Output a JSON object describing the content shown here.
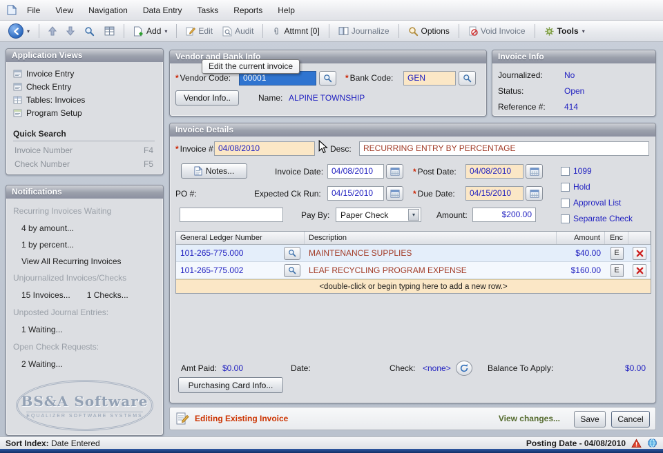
{
  "colors": {
    "required_field_bg": "#fbe7c6",
    "value_text": "#1f1fc0",
    "description_text": "#a23c28",
    "editing_status_text": "#cc3300",
    "selection_bg": "#2f74d0"
  },
  "menu": {
    "items": [
      "File",
      "View",
      "Navigation",
      "Data Entry",
      "Tasks",
      "Reports",
      "Help"
    ]
  },
  "toolbar": {
    "add": "Add",
    "edit": "Edit",
    "audit": "Audit",
    "attmnt": "Attmnt [0]",
    "journalize": "Journalize",
    "options": "Options",
    "void_invoice": "Void Invoice",
    "tools": "Tools"
  },
  "tooltip": {
    "text": "Edit the current invoice"
  },
  "sidebar": {
    "app_views": {
      "title": "Application Views",
      "items": [
        "Invoice Entry",
        "Check Entry",
        "Tables: Invoices",
        "Program Setup"
      ]
    },
    "quick_search": {
      "title": "Quick Search",
      "items": [
        {
          "label": "Invoice Number",
          "key": "F4"
        },
        {
          "label": "Check Number",
          "key": "F5"
        }
      ]
    },
    "notifications": {
      "title": "Notifications",
      "rows": [
        "Recurring Invoices Waiting",
        "4 by amount...",
        "1 by percent...",
        "View All Recurring Invoices",
        "Unjournalized Invoices/Checks",
        "15 Invoices...",
        "1 Checks...",
        "Unposted Journal Entries:",
        "1 Waiting...",
        "Open Check Requests:",
        "2 Waiting..."
      ]
    },
    "logo": {
      "line1": "BS&A Software",
      "line2": "EQUALIZER SOFTWARE SYSTEMS"
    }
  },
  "vendor_bank": {
    "title": "Vendor and Bank Info",
    "vendor_code_label": "Vendor Code:",
    "vendor_code": "00001",
    "bank_code_label": "Bank Code:",
    "bank_code": "GEN",
    "vendor_info_button": "Vendor Info..",
    "name_label": "Name:",
    "name": "ALPINE TOWNSHIP"
  },
  "invoice_info": {
    "title": "Invoice Info",
    "rows": [
      {
        "label": "Journalized:",
        "value": "No"
      },
      {
        "label": "Status:",
        "value": "Open"
      },
      {
        "label": "Reference #:",
        "value": "414"
      }
    ]
  },
  "invoice_details": {
    "title": "Invoice Details",
    "invoice_no_label": "Invoice #:",
    "invoice_no": "04/08/2010",
    "desc_label": "Desc:",
    "desc": "RECURRING ENTRY BY PERCENTAGE",
    "notes_button": "Notes...",
    "invoice_date_label": "Invoice Date:",
    "invoice_date": "04/08/2010",
    "post_date_label": "Post Date:",
    "post_date": "04/08/2010",
    "expected_ck_label": "Expected Ck Run:",
    "expected_ck": "04/15/2010",
    "due_date_label": "Due Date:",
    "due_date": "04/15/2010",
    "po_label": "PO #:",
    "po_value": "",
    "pay_by_label": "Pay By:",
    "pay_by": "Paper Check",
    "amount_label": "Amount:",
    "amount": "$200.00",
    "checkboxes": [
      "1099",
      "Hold",
      "Approval List",
      "Separate Check"
    ],
    "grid": {
      "columns": [
        "General Ledger Number",
        "Description",
        "Amount",
        "Enc"
      ],
      "rows": [
        {
          "gl": "101-265-775.000",
          "desc": "MAINTENANCE SUPPLIES",
          "amount": "$40.00",
          "enc": "E"
        },
        {
          "gl": "101-265-775.002",
          "desc": "LEAF RECYCLING PROGRAM EXPENSE",
          "amount": "$160.00",
          "enc": "E"
        }
      ],
      "new_row_hint": "<double-click or begin typing here to add a new row.>"
    },
    "amt_paid_label": "Amt Paid:",
    "amt_paid": "$0.00",
    "date_label": "Date:",
    "check_label": "Check:",
    "check_value": "<none>",
    "balance_label": "Balance To Apply:",
    "balance": "$0.00",
    "purchasing_card_button": "Purchasing Card Info..."
  },
  "footer": {
    "status": "Editing Existing Invoice",
    "view_changes": "View changes...",
    "save": "Save",
    "cancel": "Cancel"
  },
  "statusbar": {
    "sort_label": "Sort Index:",
    "sort_value": "Date Entered",
    "posting": "Posting Date - 04/08/2010"
  }
}
